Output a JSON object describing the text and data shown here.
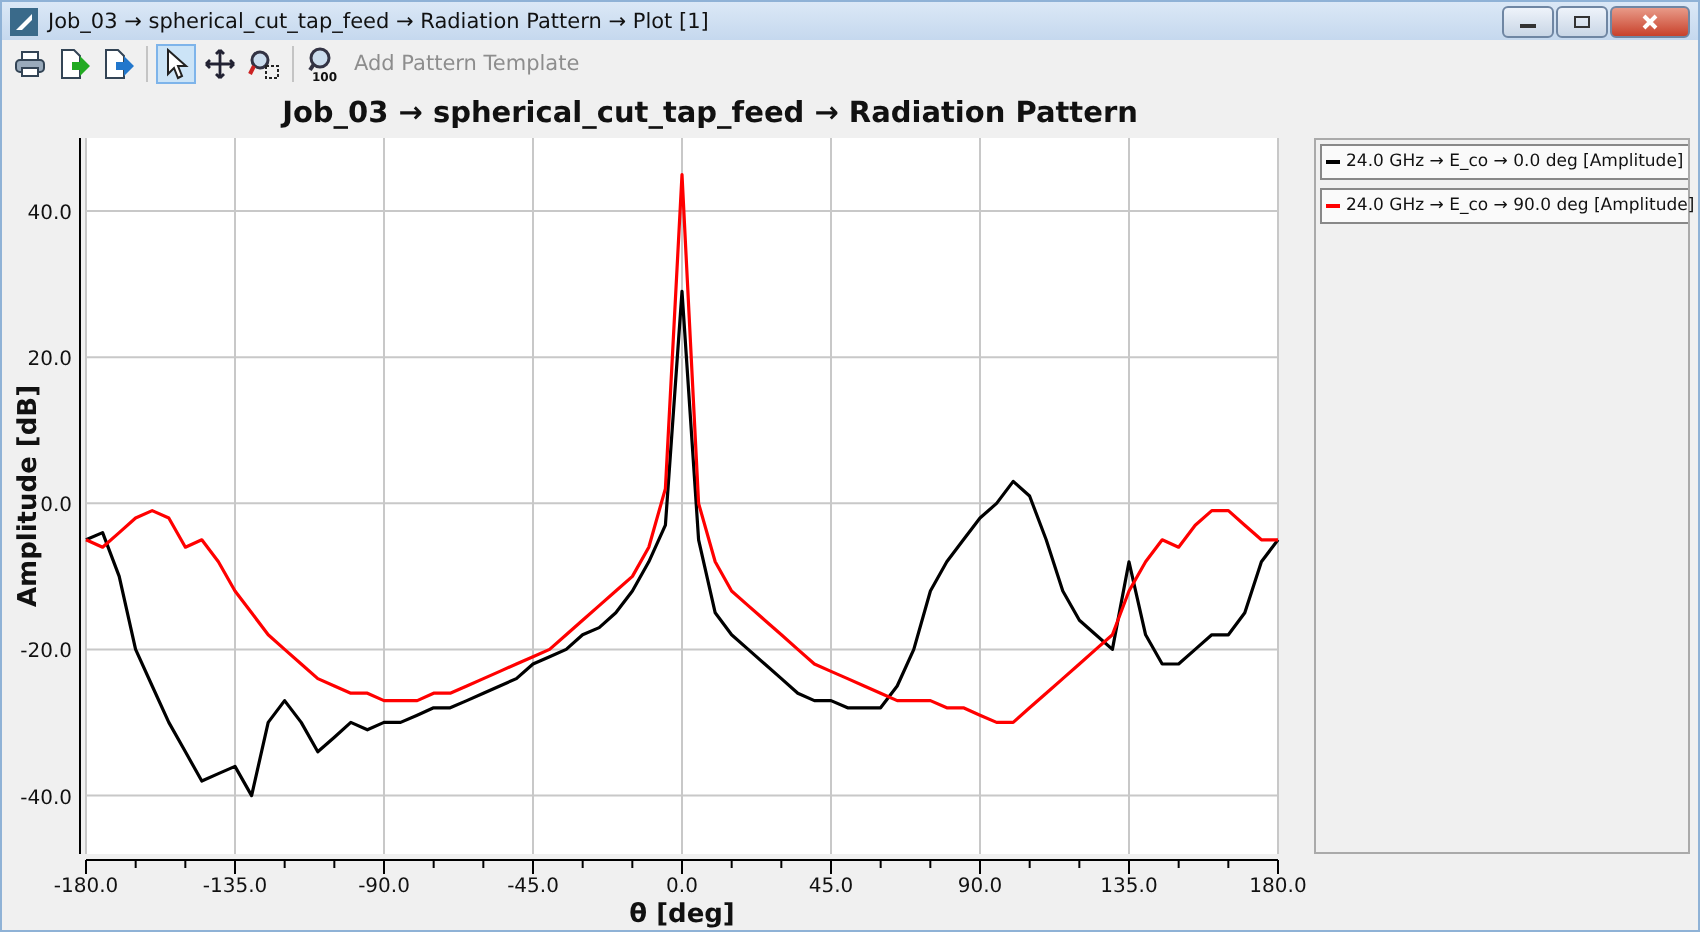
{
  "window": {
    "title": "Job_03 → spherical_cut_tap_feed → Radiation Pattern → Plot [1]"
  },
  "toolbar": [
    {
      "kind": "print",
      "selected": false
    },
    {
      "kind": "export",
      "selected": false
    },
    {
      "kind": "export-alt",
      "selected": false
    },
    {
      "kind": "separator"
    },
    {
      "kind": "pointer",
      "selected": true
    },
    {
      "kind": "pan",
      "selected": false
    },
    {
      "kind": "zoom-box",
      "selected": false
    },
    {
      "kind": "separator"
    },
    {
      "kind": "zoom-reset",
      "badge": "100",
      "selected": false
    },
    {
      "kind": "action",
      "label": "Add Pattern Template",
      "disabled": true
    }
  ],
  "chart": {
    "chart_data": {
      "type": "line",
      "title": "Job_03 → spherical_cut_tap_feed → Radiation Pattern",
      "xlabel": "θ [deg]",
      "ylabel": "Amplitude [dB]",
      "x": [
        -180,
        -175,
        -170,
        -165,
        -160,
        -155,
        -150,
        -145,
        -140,
        -135,
        -130,
        -125,
        -120,
        -115,
        -110,
        -105,
        -100,
        -95,
        -90,
        -85,
        -80,
        -75,
        -70,
        -65,
        -60,
        -55,
        -50,
        -45,
        -40,
        -35,
        -30,
        -25,
        -20,
        -15,
        -10,
        -5,
        0,
        5,
        10,
        15,
        20,
        25,
        30,
        35,
        40,
        45,
        50,
        55,
        60,
        65,
        70,
        75,
        80,
        85,
        90,
        95,
        100,
        105,
        110,
        115,
        120,
        125,
        130,
        135,
        140,
        145,
        150,
        155,
        160,
        165,
        170,
        175,
        180
      ],
      "series": [
        {
          "name": "24.0 GHz → E_co → 0.0 deg [Amplitude]",
          "color": "#000000",
          "values": [
            -5,
            -4,
            -10,
            -20,
            -25,
            -30,
            -34,
            -38,
            -37,
            -36,
            -40,
            -30,
            -27,
            -30,
            -34,
            -32,
            -30,
            -31,
            -30,
            -30,
            -29,
            -28,
            -28,
            -27,
            -26,
            -25,
            -24,
            -22,
            -21,
            -20,
            -18,
            -17,
            -15,
            -12,
            -8,
            -3,
            29,
            -5,
            -15,
            -18,
            -20,
            -22,
            -24,
            -26,
            -27,
            -27,
            -28,
            -28,
            -28,
            -25,
            -20,
            -12,
            -8,
            -5,
            -2,
            0,
            3,
            1,
            -5,
            -12,
            -16,
            -18,
            -20,
            -8,
            -18,
            -22,
            -22,
            -20,
            -18,
            -18,
            -15,
            -8,
            -5
          ]
        },
        {
          "name": "24.0 GHz → E_co → 90.0 deg [Amplitude]",
          "color": "#ff0000",
          "values": [
            -5,
            -6,
            -4,
            -2,
            -1,
            -2,
            -6,
            -5,
            -8,
            -12,
            -15,
            -18,
            -20,
            -22,
            -24,
            -25,
            -26,
            -26,
            -27,
            -27,
            -27,
            -26,
            -26,
            -25,
            -24,
            -23,
            -22,
            -21,
            -20,
            -18,
            -16,
            -14,
            -12,
            -10,
            -6,
            2,
            45,
            0,
            -8,
            -12,
            -14,
            -16,
            -18,
            -20,
            -22,
            -23,
            -24,
            -25,
            -26,
            -27,
            -27,
            -27,
            -28,
            -28,
            -29,
            -30,
            -30,
            -28,
            -26,
            -24,
            -22,
            -20,
            -18,
            -12,
            -8,
            -5,
            -6,
            -3,
            -1,
            -1,
            -3,
            -5,
            -5
          ]
        }
      ],
      "grid": true,
      "xlim": [
        -180,
        180
      ],
      "ylim": [
        -48,
        50
      ],
      "xticks": [
        {
          "value": -180,
          "label": "-180.0"
        },
        {
          "value": -135,
          "label": "-135.0"
        },
        {
          "value": -90,
          "label": "-90.0"
        },
        {
          "value": -45,
          "label": "-45.0"
        },
        {
          "value": 0,
          "label": "0.0"
        },
        {
          "value": 45,
          "label": "45.0"
        },
        {
          "value": 90,
          "label": "90.0"
        },
        {
          "value": 135,
          "label": "135.0"
        },
        {
          "value": 180,
          "label": "180.0"
        }
      ],
      "yticks": [
        {
          "value": -40,
          "label": "-40.0"
        },
        {
          "value": -20,
          "label": "-20.0"
        },
        {
          "value": 0,
          "label": "0.0"
        },
        {
          "value": 20,
          "label": "20.0"
        },
        {
          "value": 40,
          "label": "40.0"
        }
      ]
    }
  }
}
